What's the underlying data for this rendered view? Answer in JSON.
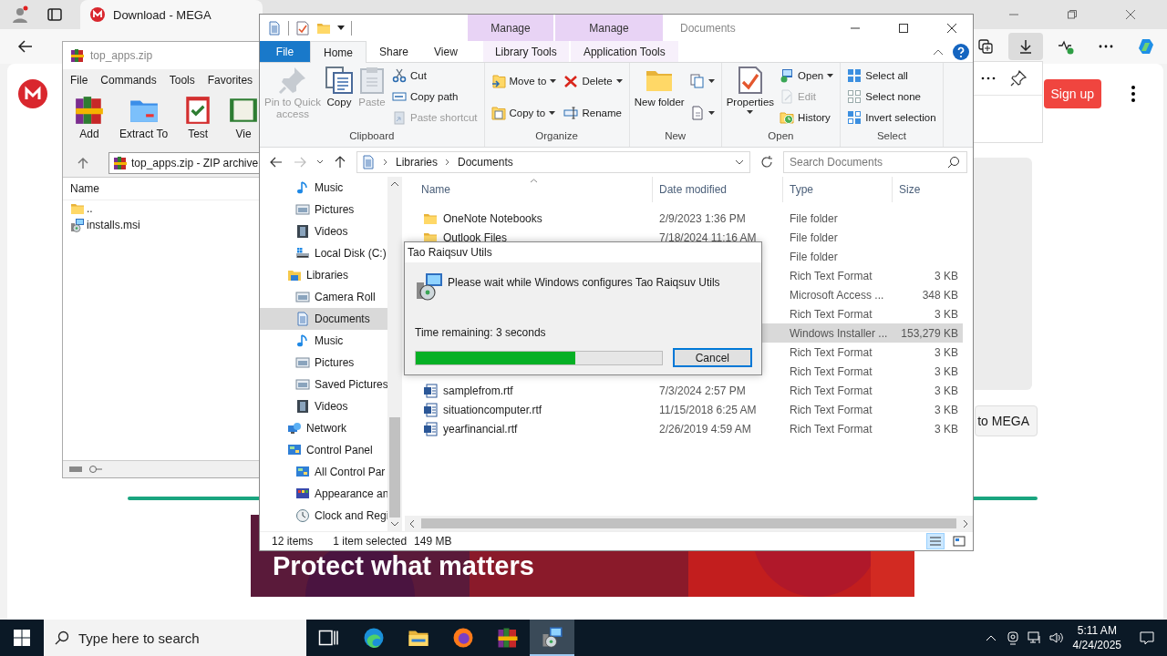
{
  "browser": {
    "tab": {
      "title": "Download - MEGA"
    },
    "sign_up": "Sign up",
    "partial_button": "to MEGA",
    "banner": {
      "kind": "picture",
      "headline": "Protect what matters"
    }
  },
  "winrar": {
    "title": "top_apps.zip",
    "menu": [
      "File",
      "Commands",
      "Tools",
      "Favorites"
    ],
    "toolbar": [
      {
        "label": "Add",
        "kind": "winrar"
      },
      {
        "label": "Extract To",
        "kind": "extract"
      },
      {
        "label": "Test",
        "kind": "test"
      },
      {
        "label": "Vie",
        "kind": "book"
      }
    ],
    "path": "top_apps.zip - ZIP archive",
    "column": "Name",
    "files": [
      {
        "name": "..",
        "kind": "folder"
      },
      {
        "name": "installs.msi",
        "kind": "msi"
      }
    ]
  },
  "explorer": {
    "title": "Documents",
    "tabs": [
      {
        "label": "File",
        "kind": "file",
        "selected": false
      },
      {
        "label": "Home",
        "kind": "plain",
        "selected": true
      },
      {
        "label": "Share",
        "kind": "plain",
        "selected": false
      },
      {
        "label": "View",
        "kind": "plain",
        "selected": false
      },
      {
        "label": "Library Tools",
        "kind": "context",
        "header": "Manage",
        "selected": false
      },
      {
        "label": "Application Tools",
        "kind": "context",
        "header": "Manage",
        "selected": false
      }
    ],
    "ribbon": [
      {
        "label": "Clipboard",
        "columns": [
          {
            "kind": "large",
            "buttons": [
              {
                "label": "Pin to Quick access",
                "kind": "pin",
                "disabled": true,
                "menu": false
              }
            ]
          },
          {
            "kind": "large",
            "buttons": [
              {
                "label": "Copy",
                "kind": "copy",
                "disabled": false,
                "menu": false
              }
            ]
          },
          {
            "kind": "large",
            "buttons": [
              {
                "label": "Paste",
                "kind": "paste",
                "disabled": true,
                "menu": false
              }
            ]
          },
          {
            "kind": "stack",
            "buttons": [
              {
                "label": "Cut",
                "kind": "cut",
                "disabled": false,
                "menu": false
              },
              {
                "label": "Copy path",
                "kind": "copypath",
                "disabled": false,
                "menu": false
              },
              {
                "label": "Paste shortcut",
                "kind": "pasteshortcut",
                "disabled": true,
                "menu": false
              }
            ]
          }
        ]
      },
      {
        "label": "Organize",
        "columns": [
          {
            "kind": "stack",
            "buttons": [
              {
                "label": "Move to",
                "kind": "moveto",
                "disabled": false,
                "menu": true
              },
              {
                "label": "Copy to",
                "kind": "copyto",
                "disabled": false,
                "menu": true
              }
            ]
          },
          {
            "kind": "stack",
            "buttons": [
              {
                "label": "Delete",
                "kind": "delete",
                "disabled": false,
                "menu": true
              },
              {
                "label": "Rename",
                "kind": "rename",
                "disabled": false,
                "menu": false
              }
            ]
          }
        ]
      },
      {
        "label": "New",
        "columns": [
          {
            "kind": "large",
            "buttons": [
              {
                "label": "New folder",
                "kind": "newfolder",
                "disabled": false,
                "menu": false
              }
            ]
          },
          {
            "kind": "stack",
            "buttons": [
              {
                "kind": "newitem",
                "disabled": false,
                "menu": true
              },
              {
                "kind": "easyaccess",
                "disabled": false,
                "menu": true
              }
            ]
          }
        ]
      },
      {
        "label": "Open",
        "columns": [
          {
            "kind": "large",
            "buttons": [
              {
                "label": "Properties",
                "kind": "properties",
                "disabled": false,
                "menu": true
              }
            ]
          },
          {
            "kind": "stack",
            "buttons": [
              {
                "label": "Open",
                "kind": "open",
                "disabled": false,
                "menu": true
              },
              {
                "label": "Edit",
                "kind": "edit",
                "disabled": true,
                "menu": false
              },
              {
                "label": "History",
                "kind": "history",
                "disabled": false,
                "menu": false
              }
            ]
          }
        ]
      },
      {
        "label": "Select",
        "columns": [
          {
            "kind": "stack",
            "buttons": [
              {
                "label": "Select all",
                "kind": "selectall",
                "disabled": false,
                "menu": false
              },
              {
                "label": "Select none",
                "kind": "selectnone",
                "disabled": false,
                "menu": false
              },
              {
                "label": "Invert selection",
                "kind": "invert",
                "disabled": false,
                "menu": false
              }
            ]
          }
        ]
      }
    ],
    "address": [
      "Libraries",
      "Documents"
    ],
    "search": {
      "placeholder": "Search Documents"
    },
    "nav": [
      {
        "children": [
          {
            "label": "Music",
            "kind": "music",
            "selected": false
          },
          {
            "label": "Pictures",
            "kind": "pictures",
            "selected": false
          },
          {
            "label": "Videos",
            "kind": "videos",
            "selected": false
          },
          {
            "label": "Local Disk (C:)",
            "kind": "disk",
            "selected": false
          }
        ]
      },
      {
        "label": "Libraries",
        "kind": "library",
        "selected": false,
        "children": [
          {
            "label": "Camera Roll",
            "kind": "pictures",
            "selected": false
          },
          {
            "label": "Documents",
            "kind": "documents",
            "selected": true
          },
          {
            "label": "Music",
            "kind": "music",
            "selected": false
          },
          {
            "label": "Pictures",
            "kind": "pictures",
            "selected": false
          },
          {
            "label": "Saved Pictures",
            "kind": "pictures",
            "selected": false
          },
          {
            "label": "Videos",
            "kind": "videos",
            "selected": false
          }
        ]
      },
      {
        "label": "Network",
        "kind": "network",
        "selected": false
      },
      {
        "label": "Control Panel",
        "kind": "control",
        "selected": false,
        "children": [
          {
            "label": "All Control Par",
            "kind": "control",
            "selected": false
          },
          {
            "label": "Appearance an",
            "kind": "appearance",
            "selected": false
          },
          {
            "label": "Clock and Regi",
            "kind": "clock",
            "selected": false
          }
        ]
      }
    ],
    "columns": [
      "Name",
      "Date modified",
      "Type",
      "Size"
    ],
    "rows": [
      {
        "name": "OneNote Notebooks",
        "kind": "folder",
        "date": "2/9/2023 1:36 PM",
        "type": "File folder",
        "selected": false
      },
      {
        "name": "Outlook Files",
        "kind": "folder",
        "date": "7/18/2024 11:16 AM",
        "type": "File folder",
        "selected": false
      },
      {
        "type": "File folder",
        "selected": false
      },
      {
        "type": "Rich Text Format",
        "size": "3 KB",
        "selected": false
      },
      {
        "type": "Microsoft Access ...",
        "size": "348 KB",
        "selected": false
      },
      {
        "type": "Rich Text Format",
        "size": "3 KB",
        "selected": false
      },
      {
        "type": "Windows Installer ...",
        "size": "153,279 KB",
        "selected": true
      },
      {
        "type": "Rich Text Format",
        "size": "3 KB",
        "selected": false
      },
      {
        "type": "Rich Text Format",
        "size": "3 KB",
        "selected": false
      },
      {
        "name": "samplefrom.rtf",
        "kind": "rtf",
        "date": "7/3/2024 2:57 PM",
        "type": "Rich Text Format",
        "size": "3 KB",
        "selected": false
      },
      {
        "name": "situationcomputer.rtf",
        "kind": "rtf",
        "date": "11/15/2018 6:25 AM",
        "type": "Rich Text Format",
        "size": "3 KB",
        "selected": false
      },
      {
        "name": "yearfinancial.rtf",
        "kind": "rtf",
        "date": "2/26/2019 4:59 AM",
        "type": "Rich Text Format",
        "size": "3 KB",
        "selected": false
      }
    ],
    "status": {
      "count": "12 items",
      "selection": "1 item selected",
      "size": "149 MB"
    }
  },
  "dialog": {
    "title": "Tao Raiqsuv Utils",
    "message": "Please wait while Windows configures Tao Raiqsuv Utils",
    "time": "Time remaining: 3 seconds",
    "level": 0.65,
    "button": "Cancel"
  },
  "taskbar": {
    "search": {
      "placeholder": "Type here to search"
    },
    "apps": [
      {
        "kind": "taskview",
        "selected": false
      },
      {
        "kind": "edge",
        "selected": false
      },
      {
        "kind": "explorer",
        "selected": false
      },
      {
        "kind": "firefox",
        "selected": false
      },
      {
        "kind": "winrar",
        "selected": false
      },
      {
        "kind": "msi",
        "selected": true
      }
    ],
    "time": "5:11 AM",
    "date": "4/24/2025"
  }
}
